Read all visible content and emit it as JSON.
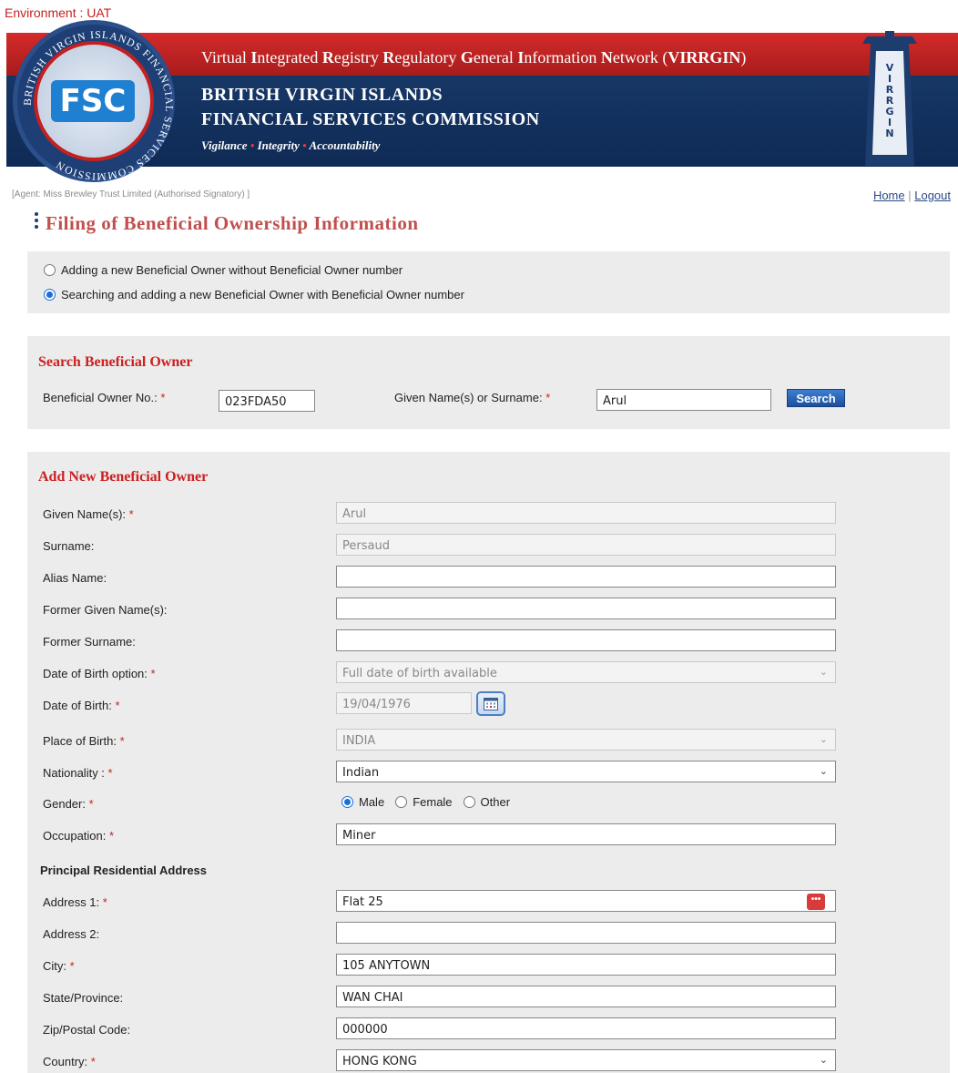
{
  "env": "Environment : UAT",
  "header": {
    "tagline_parts": [
      "Virtual ",
      "I",
      "ntegrated ",
      "R",
      "egistry ",
      "R",
      "egulatory ",
      "G",
      "eneral ",
      "I",
      "nformation ",
      "N",
      "etwork (",
      "VIRRGIN",
      ")"
    ],
    "org_line1": "BRITISH VIRGIN ISLANDS",
    "org_line2": "FINANCIAL SERVICES COMMISSION",
    "motto_1": "Vigilance",
    "motto_2": "Integrity",
    "motto_3": "Accountability",
    "logo_text": "FSC",
    "seal_text": "BRITISH VIRGIN ISLANDS FINANCIAL SERVICES COMMISSION",
    "lighthouse_text": "VIRRGIN"
  },
  "agent": "[Agent: Miss Brewley Trust Limited (Authorised Signatory) ]",
  "nav": {
    "home": "Home",
    "sep": " | ",
    "logout": "Logout"
  },
  "page_title": "Filing of Beneficial Ownership Information",
  "mode_options": [
    {
      "label": "Adding a new Beneficial Owner without Beneficial Owner number",
      "selected": false
    },
    {
      "label": "Searching and adding a new Beneficial Owner with Beneficial Owner number",
      "selected": true
    }
  ],
  "search": {
    "title": "Search Beneficial Owner",
    "bo_no_label": "Beneficial Owner No.:",
    "bo_no_value": "023FDA50",
    "name_label": "Given Name(s) or Surname:",
    "name_value": "Arul",
    "button": "Search"
  },
  "form": {
    "title": "Add New Beneficial Owner",
    "given_names": {
      "label": "Given Name(s):",
      "value": "Arul"
    },
    "surname": {
      "label": "Surname:",
      "value": "Persaud"
    },
    "alias": {
      "label": "Alias Name:",
      "value": ""
    },
    "former_given": {
      "label": "Former Given Name(s):",
      "value": ""
    },
    "former_surname": {
      "label": "Former Surname:",
      "value": ""
    },
    "dob_option": {
      "label": "Date of Birth option:",
      "value": "Full date of birth available"
    },
    "dob": {
      "label": "Date of Birth:",
      "value": "19/04/1976"
    },
    "pob": {
      "label": "Place of Birth:",
      "value": "INDIA"
    },
    "nationality": {
      "label": "Nationality :",
      "value": "Indian"
    },
    "gender": {
      "label": "Gender:",
      "options": [
        "Male",
        "Female",
        "Other"
      ],
      "selected": "Male"
    },
    "occupation": {
      "label": "Occupation:",
      "value": "Miner"
    },
    "address_heading": "Principal Residential Address",
    "address1": {
      "label": "Address 1:",
      "value": "Flat 25"
    },
    "address2": {
      "label": "Address 2:",
      "value": ""
    },
    "city": {
      "label": "City:",
      "value": "105 ANYTOWN"
    },
    "state": {
      "label": "State/Province:",
      "value": "WAN CHAI"
    },
    "zip": {
      "label": "Zip/Postal Code:",
      "value": "000000"
    },
    "country": {
      "label": "Country:",
      "value": "HONG KONG"
    }
  },
  "required_marker": "*",
  "colors": {
    "brand_blue": "#1a3d6e",
    "brand_red": "#c81e1e",
    "title_red": "#c0504d",
    "link": "#2b4a8a",
    "panel": "#ececec"
  },
  "icons": {
    "calendar": "calendar-icon",
    "more": "more-icon",
    "chevron": "chevron-down-icon"
  }
}
